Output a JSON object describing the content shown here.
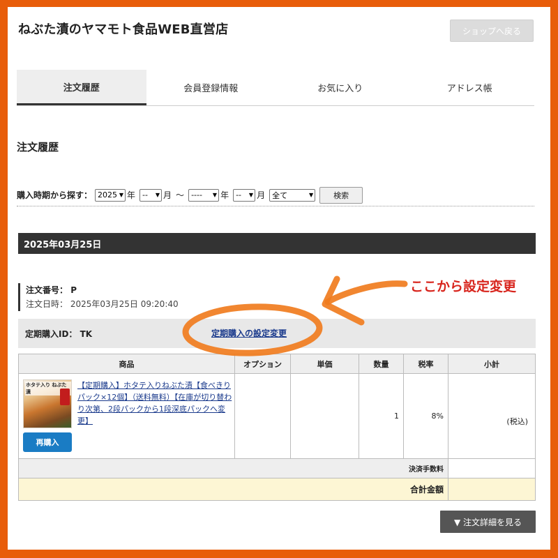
{
  "header": {
    "shop_title": "ねぶた漬のヤマモト食品WEB直営店",
    "back_button": "ショップへ戻る"
  },
  "tabs": [
    {
      "label": "注文履歴",
      "active": true
    },
    {
      "label": "会員登録情報",
      "active": false
    },
    {
      "label": "お気に入り",
      "active": false
    },
    {
      "label": "アドレス帳",
      "active": false
    }
  ],
  "section_title": "注文履歴",
  "search": {
    "label": "購入時期から探す：",
    "year_from": "2025",
    "year_unit": "年",
    "month_from": "--",
    "month_unit": "月",
    "tilde": "～",
    "year_to": "----",
    "month_to": "--",
    "status": "全て",
    "button": "検索"
  },
  "order": {
    "date_header": "2025年03月25日",
    "number_label": "注文番号：",
    "number_value": "P",
    "datetime_label": "注文日時：",
    "datetime_value": "2025年03月25日 09:20:40",
    "teiki_label": "定期購入ID：",
    "teiki_value": "TK",
    "teiki_link": "定期購入の設定変更"
  },
  "table": {
    "headers": [
      "商品",
      "オプション",
      "単価",
      "数量",
      "税率",
      "小計"
    ],
    "item": {
      "thumb_text": "ホタテ入り ねぶた漬",
      "product_name": "【定期購入】ホタテ入りねぶた漬【食べきりパック×12個】（送料無料）【在庫が切り替わり次第、2段パックから1段深底パックへ変更】",
      "rebuy": "再購入",
      "option": "",
      "unit_price": "",
      "qty": "1",
      "tax_rate": "8%",
      "subtotal": "(税込)"
    },
    "fee_label": "決済手数料",
    "fee_value": "",
    "total_label": "合計金額",
    "total_value": ""
  },
  "detail_button": "▼ 注文詳細を見る",
  "annotation": "ここから設定変更",
  "colors": {
    "frame": "#e85d0a",
    "annotation": "#d8251d",
    "link": "#1a3a8c",
    "rebuy": "#1a7cc4",
    "date_bar": "#333333",
    "total_bg": "#fdf6d4"
  }
}
